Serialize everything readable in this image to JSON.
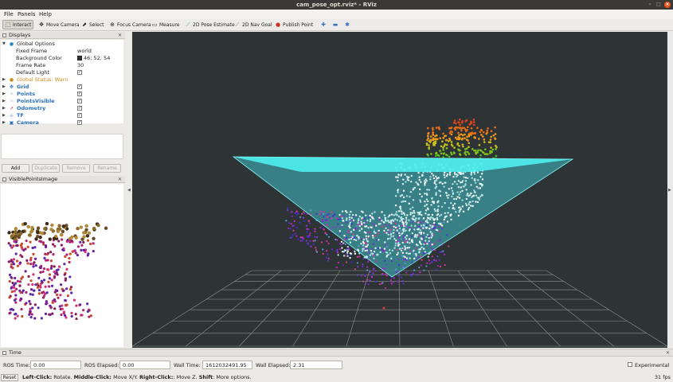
{
  "window": {
    "title": "cam_pose_opt.rviz* - RViz"
  },
  "menu": [
    {
      "label": "File"
    },
    {
      "label": "Panels"
    },
    {
      "label": "Help"
    }
  ],
  "toolbar": {
    "tools": [
      {
        "label": "Interact",
        "icon": "interact-icon",
        "active": true
      },
      {
        "label": "Move Camera",
        "icon": "move-camera-icon"
      },
      {
        "label": "Select",
        "icon": "select-icon"
      },
      {
        "label": "Focus Camera",
        "icon": "focus-camera-icon"
      },
      {
        "label": "Measure",
        "icon": "measure-icon"
      },
      {
        "label": "2D Pose Estimate",
        "icon": "pose-estimate-icon",
        "color": "#3a9a3a"
      },
      {
        "label": "2D Nav Goal",
        "icon": "nav-goal-icon",
        "color": "#b04080"
      },
      {
        "label": "Publish Point",
        "icon": "publish-point-icon",
        "color": "#d03020"
      }
    ]
  },
  "displays_panel": {
    "title": "Displays",
    "global_options": {
      "label": "Global Options",
      "props": [
        {
          "name": "Fixed Frame",
          "value": "world"
        },
        {
          "name": "Background Color",
          "value": "46; 52; 54",
          "swatch": "#2e3436"
        },
        {
          "name": "Frame Rate",
          "value": "30"
        },
        {
          "name": "Default Light",
          "value": "✓"
        }
      ]
    },
    "global_status": "Global Status: Warn",
    "items": [
      {
        "label": "Grid",
        "icon": "grid-icon",
        "checked": "✓"
      },
      {
        "label": "Points",
        "icon": "points-icon",
        "checked": "✓"
      },
      {
        "label": "PointsVisible",
        "icon": "points-icon",
        "checked": "✓"
      },
      {
        "label": "Odometry",
        "icon": "odometry-icon",
        "checked": "✓"
      },
      {
        "label": "TF",
        "icon": "tf-icon",
        "checked": "✓"
      },
      {
        "label": "Camera",
        "icon": "camera-icon",
        "checked": "✓"
      }
    ],
    "buttons": {
      "add": "Add",
      "duplicate": "Duplicate",
      "remove": "Remove",
      "rename": "Rename"
    }
  },
  "image_panel": {
    "title": "VisiblePointsImage"
  },
  "time_panel": {
    "title": "Time",
    "ros_time_label": "ROS Time:",
    "ros_time": "0.00",
    "ros_elapsed_label": "ROS Elapsed:",
    "ros_elapsed": "0.00",
    "wall_time_label": "Wall Time:",
    "wall_time": "1612032491.95",
    "wall_elapsed_label": "Wall Elapsed:",
    "wall_elapsed": "2.31",
    "experimental": "Experimental"
  },
  "status": {
    "reset": "Reset",
    "hint_lc": "Left-Click:",
    "hint_lc_text": " Rotate. ",
    "hint_mc": "Middle-Click:",
    "hint_mc_text": " Move X/Y. ",
    "hint_rc": "Right-Click:",
    "hint_rc_text": ": Move Z. ",
    "hint_shift": "Shift",
    "hint_shift_text": ": More options.",
    "fps": "31 fps"
  },
  "colors": {
    "view_background": "#2e3436",
    "frustum": "#4ff0f0",
    "warn": "#d08a1d",
    "accent_blue": "#2a6fbd"
  }
}
